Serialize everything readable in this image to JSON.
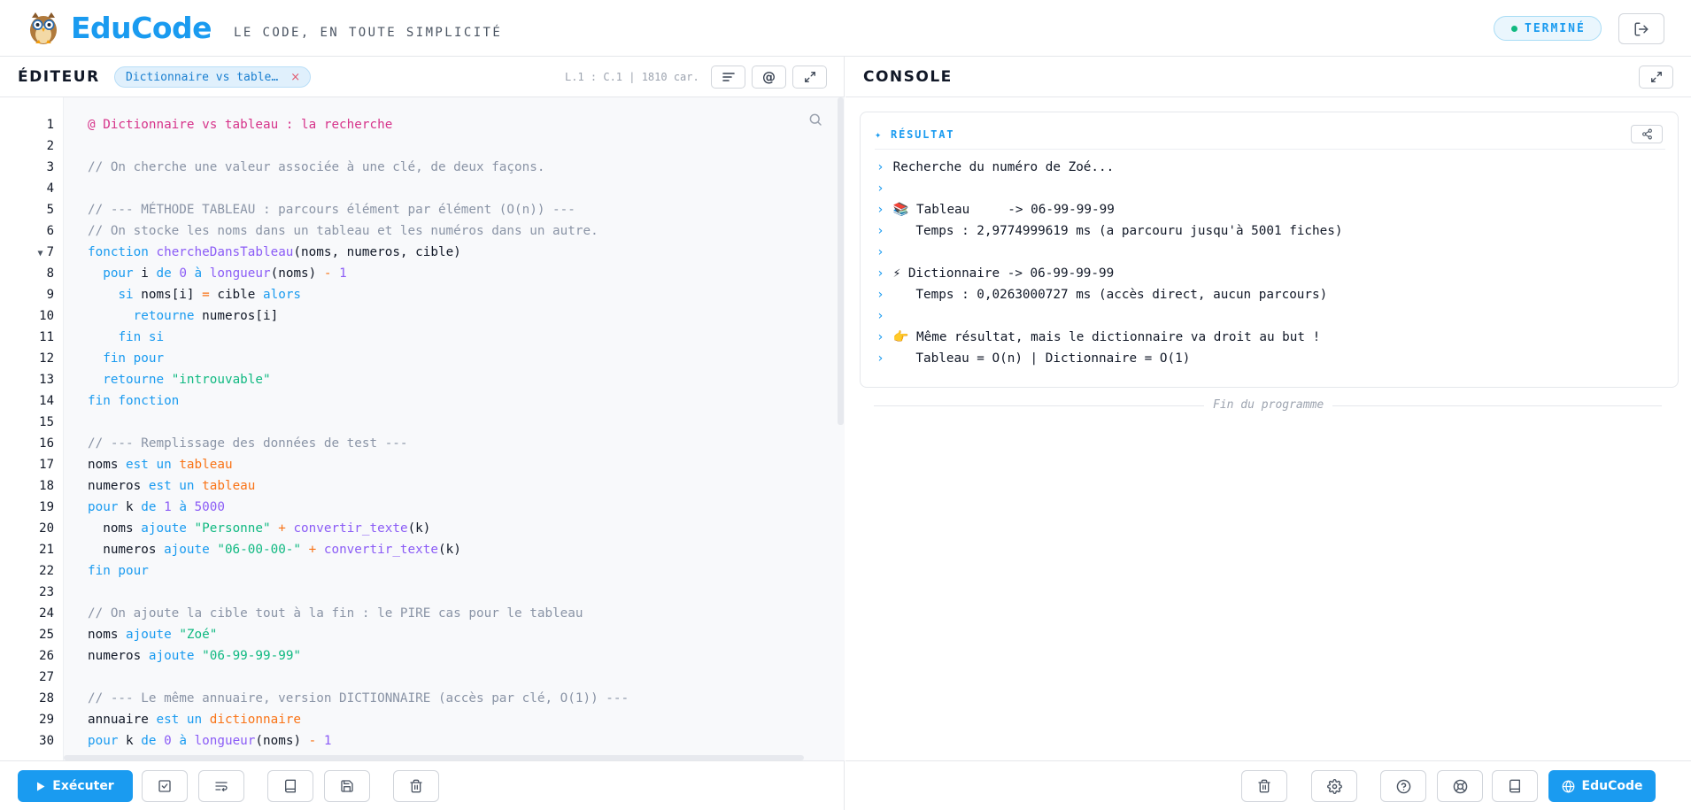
{
  "header": {
    "brand": "EduCode",
    "tagline": "LE CODE, EN TOUTE SIMPLICITÉ",
    "status": "TERMINÉ",
    "logout_icon": "logout-icon"
  },
  "editor": {
    "title": "ÉDITEUR",
    "file_tab": "Dictionnaire vs table…",
    "file_tab_close": "×",
    "cursor_info": "L.1 : C.1 | 1810 car.",
    "line_numbers": [
      "1",
      "2",
      "3",
      "4",
      "5",
      "6",
      "7",
      "8",
      "9",
      "10",
      "11",
      "12",
      "13",
      "14",
      "15",
      "16",
      "17",
      "18",
      "19",
      "20",
      "21",
      "22",
      "23",
      "24",
      "25",
      "26",
      "27",
      "28",
      "29",
      "30"
    ],
    "folded_line_marker": "▼",
    "code": {
      "l1": "@ Dictionnaire vs tableau : la recherche",
      "l3": "// On cherche une valeur associée à une clé, de deux façons.",
      "l5": "// --- MÉTHODE TABLEAU : parcours élément par élément (O(n)) ---",
      "l6": "// On stocke les noms dans un tableau et les numéros dans un autre.",
      "l16": "// --- Remplissage des données de test ---",
      "l24": "// On ajoute la cible tout à la fin : le PIRE cas pour le tableau",
      "l28": "// --- Le même annuaire, version DICTIONNAIRE (accès par clé, O(1)) ---"
    },
    "buttons": {
      "run": "Exécuter"
    }
  },
  "console": {
    "title": "CONSOLE",
    "result_header": "✦ RÉSULTAT",
    "prompt": "›",
    "output": [
      "Recherche du numéro de Zoé...",
      "",
      "📚 Tableau     -> 06-99-99-99",
      "   Temps : 2,9774999619 ms (a parcouru jusqu'à 5001 fiches)",
      "",
      "⚡ Dictionnaire -> 06-99-99-99",
      "   Temps : 0,0263000727 ms (accès direct, aucun parcours)",
      "",
      "👉 Même résultat, mais le dictionnaire va droit au but !",
      "   Tableau = O(n) | Dictionnaire = O(1)"
    ],
    "end_text": "Fin du programme",
    "brand_button": "EduCode"
  },
  "colors": {
    "accent": "#1a9bf0",
    "keyword": "#1a9bf0",
    "function": "#8b5cf6",
    "string": "#10b981",
    "operator": "#f97316",
    "comment": "#8a94a6",
    "annotation": "#d6338a"
  }
}
